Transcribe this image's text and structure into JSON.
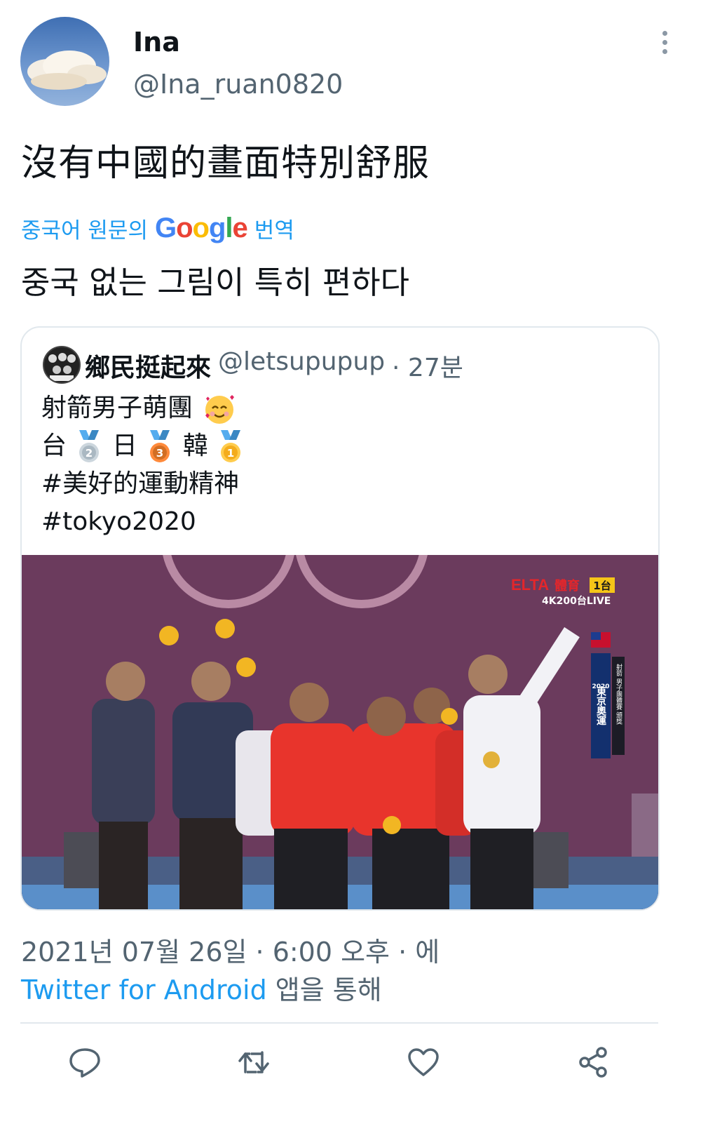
{
  "tweet": {
    "author_name": "Ina",
    "author_handle": "@Ina_ruan0820",
    "text": "沒有中國的畫面特別舒服",
    "translate_prefix": "중국어 원문의",
    "translate_brand": "Google",
    "translate_suffix": "번역",
    "translated_text": "중국 없는 그림이 특히 편하다",
    "timestamp": "2021년 07월 26일 · 6:00 오후 · 에",
    "source_link": "Twitter for Android",
    "source_suffix": "앱을 통해"
  },
  "quoted": {
    "author_name": "鄉民挺起來",
    "author_handle": "@letsupupup",
    "time": "· 27분",
    "line1": "射箭男子萌團",
    "line2_a": "台",
    "line2_b": "日",
    "line2_c": "韓",
    "medal_silver": "2",
    "medal_bronze": "3",
    "medal_gold": "1",
    "hashtag1": "#美好的運動精神",
    "hashtag2": "#tokyo2020"
  },
  "broadcast": {
    "logo": "ELTA",
    "logo_sub": "體育",
    "channel": "1台",
    "live": "4K200台LIVE",
    "tag_year": "2020",
    "tag_event": "東京奧運",
    "tag_side": "射箭 男子團體賽 頒獎"
  },
  "icons": [
    "reply-icon",
    "retweet-icon",
    "like-icon",
    "share-icon",
    "more-icon"
  ],
  "colors": {
    "accent": "#1d9bf0",
    "text": "#0f1419",
    "muted": "#536471",
    "border": "#e1e8ed"
  }
}
